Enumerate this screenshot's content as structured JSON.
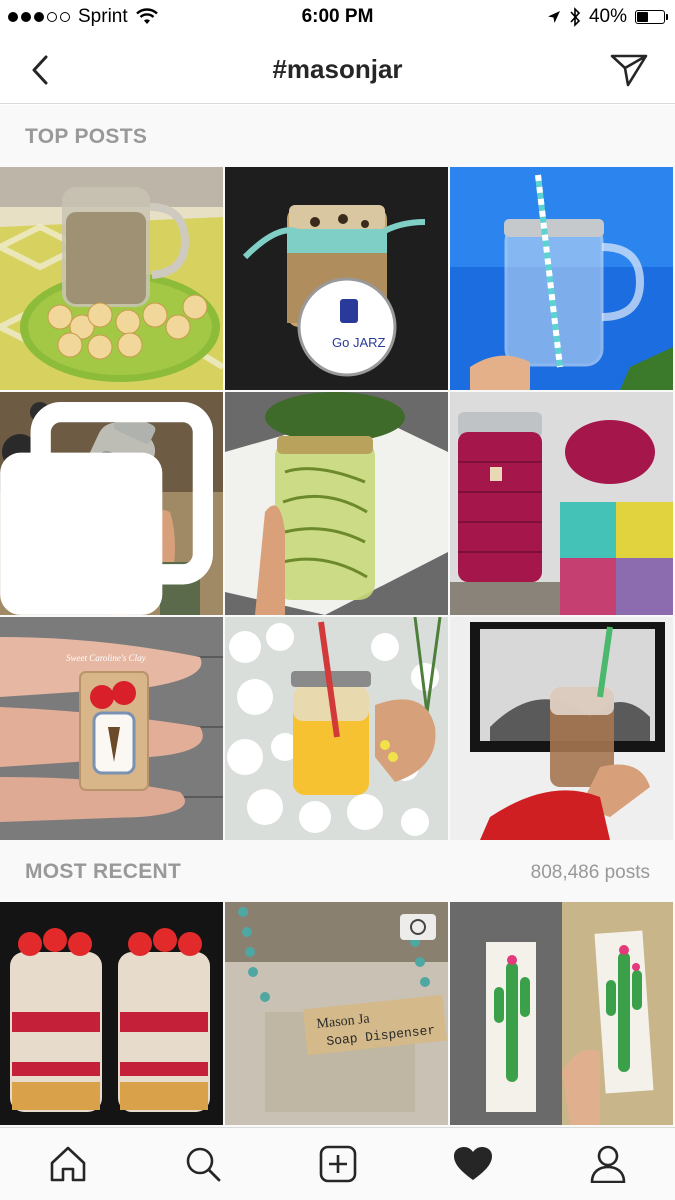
{
  "status": {
    "carrier": "Sprint",
    "time": "6:00 PM",
    "battery": "40%",
    "battery_level": 0.4
  },
  "nav": {
    "title": "#masonjar",
    "back_icon": "chevron-left-icon",
    "send_icon": "direct-send-icon"
  },
  "top_posts": {
    "label": "TOP POSTS",
    "posts": [
      {
        "subject": "overnight oats jar with banana slices",
        "multi": false
      },
      {
        "subject": "cookie in a jar with GoJarz tag",
        "multi": false
      },
      {
        "subject": "mason jar mug with striped straw against blue sky",
        "multi": false
      },
      {
        "subject": "hand holding old glass bottle",
        "multi": true
      },
      {
        "subject": "jar of zucchini noodles",
        "multi": false
      },
      {
        "subject": "crochet jar cozy",
        "multi": false
      },
      {
        "subject": "clay mason jar miniature",
        "multi": false
      },
      {
        "subject": "yellow smoothie jar among white flowers",
        "multi": false
      },
      {
        "subject": "iced coffee mason jar",
        "multi": false
      }
    ],
    "watermark_text": "Sweet Caroline's Clay",
    "gojarz_text": "Go JARZ"
  },
  "most_recent": {
    "label": "MOST RECENT",
    "count": "808,486 posts",
    "posts": [
      {
        "subject": "strawberry parfait jars"
      },
      {
        "subject": "mason jar soap dispenser package"
      },
      {
        "subject": "cactus painted wood panels"
      }
    ],
    "label_text_line1": "Mason Ja",
    "label_text_line2": "Soap Dispenser"
  },
  "tabs": [
    {
      "name": "home",
      "icon": "home-icon"
    },
    {
      "name": "search",
      "icon": "search-icon"
    },
    {
      "name": "add",
      "icon": "add-post-icon"
    },
    {
      "name": "activity",
      "icon": "heart-icon"
    },
    {
      "name": "profile",
      "icon": "profile-icon"
    }
  ],
  "colors": {
    "section_text": "#999999",
    "title_text": "#262626",
    "divider": "#dbdbdb"
  }
}
